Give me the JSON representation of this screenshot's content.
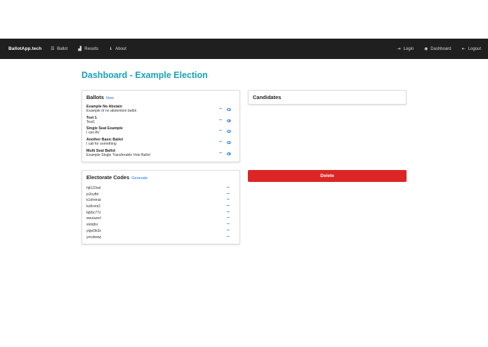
{
  "navbar": {
    "brand": "BallotApp.tech",
    "left_items": [
      {
        "label": "Ballot",
        "icon": "list-icon"
      },
      {
        "label": "Results",
        "icon": "chart-icon"
      },
      {
        "label": "About",
        "icon": "info-icon"
      }
    ],
    "right_items": [
      {
        "label": "Login",
        "icon": "login-icon"
      },
      {
        "label": "Dashboard",
        "icon": "dashboard-icon"
      },
      {
        "label": "Logout",
        "icon": "logout-icon"
      }
    ]
  },
  "page": {
    "title": "Dashboard - Example Election"
  },
  "ballots": {
    "title": "Ballots",
    "new_label": "New",
    "items": [
      {
        "name": "Example No Abstain",
        "description": "Example of no abstention ballot"
      },
      {
        "name": "Test 1",
        "description": "Test1"
      },
      {
        "name": "Single Seat Example",
        "description": "I use AV"
      },
      {
        "name": "Another Basic Ballot",
        "description": "I call for something"
      },
      {
        "name": "Multi Seat Ballot",
        "description": "Example Single Transferable Vote Ballot"
      }
    ]
  },
  "candidates": {
    "title": "Candidates"
  },
  "electorate": {
    "title": "Electorate Codes",
    "generate_label": "Generate",
    "codes": [
      "hjk123sd",
      "js3nyfbt",
      "k1dmtnal",
      "ku8vvts2",
      "tqbbc77z",
      "wwzazerl",
      "xletqfsr",
      "yigw5k3s",
      "yxrukwwj"
    ]
  },
  "actions": {
    "delete_label": "Delete"
  },
  "colors": {
    "navbar_bg": "#1f1f1f",
    "title_accent": "#17a2b8",
    "link_blue": "#1a73e8",
    "delete_red": "#dc2626"
  }
}
